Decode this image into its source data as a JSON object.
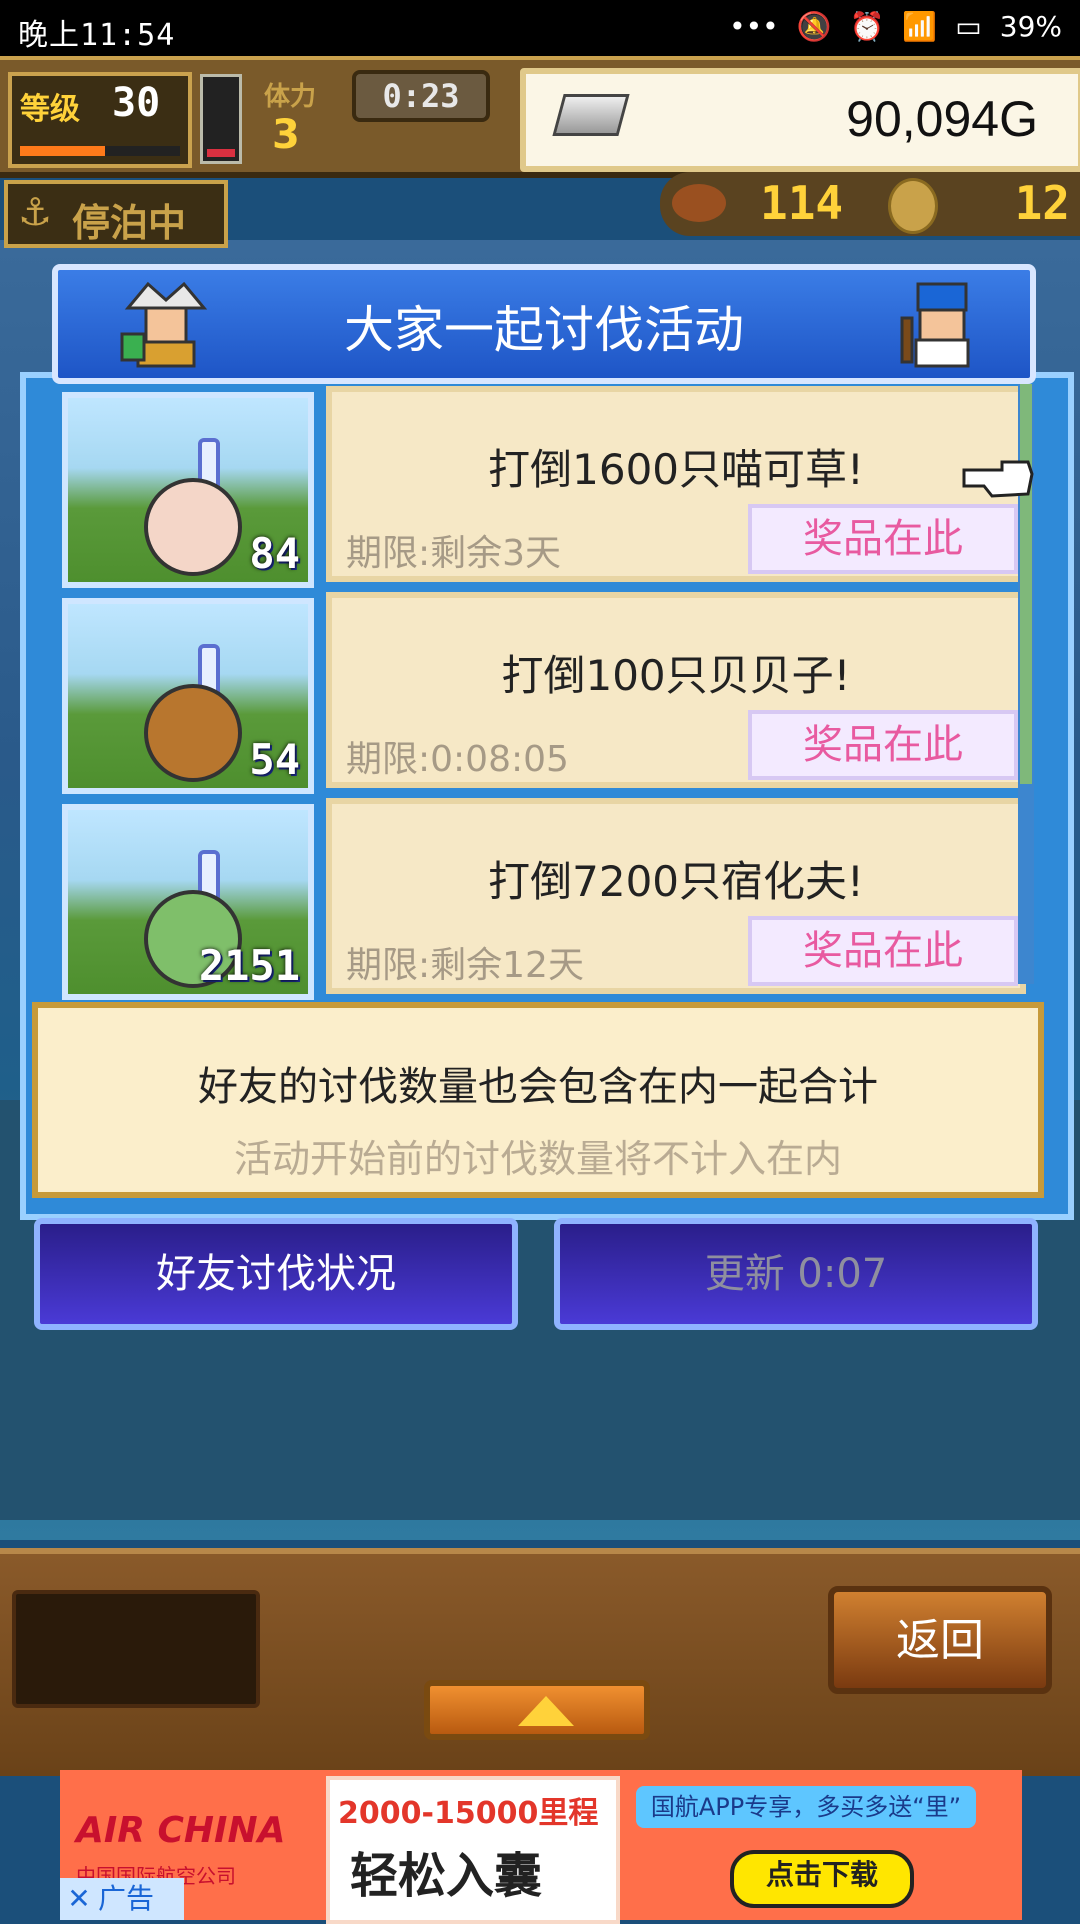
{
  "status_bar": {
    "time": "晚上11:54",
    "battery": "39%"
  },
  "hud": {
    "level_label": "等级",
    "level": "30",
    "stamina_label": "体力",
    "stamina": "3",
    "timer": "0:23",
    "gold": "90,094G",
    "docked_label": "停泊中",
    "resource_food": "114",
    "resource_coins": "12"
  },
  "dialog": {
    "title": "大家一起讨伐活动",
    "quests": [
      {
        "name": "打倒1600只喵可草!",
        "deadline": "期限:剩余3天",
        "prize": "奖品在此",
        "count": "84",
        "monster_color": "#f4d6c8"
      },
      {
        "name": "打倒100只贝贝子!",
        "deadline": "期限:0:08:05",
        "prize": "奖品在此",
        "count": "54",
        "monster_color": "#b8762e"
      },
      {
        "name": "打倒7200只宿化夫!",
        "deadline": "期限:剩余12天",
        "prize": "奖品在此",
        "count": "2151",
        "monster_color": "#7fbf6a"
      }
    ],
    "note_line1": "好友的讨伐数量也会包含在内一起合计",
    "note_line2": "活动开始前的讨伐数量将不计入在内"
  },
  "buttons": {
    "friends": "好友讨伐状况",
    "refresh": "更新 0:07",
    "back": "返回"
  },
  "ad": {
    "brand": "AIR CHINA",
    "brand_cn": "中国国际航空公司",
    "miles": "2000-15000里程",
    "slogan": "轻松入囊",
    "tag": "国航APP专享，多买多送“里”",
    "download": "点击下载",
    "label": "广告"
  }
}
